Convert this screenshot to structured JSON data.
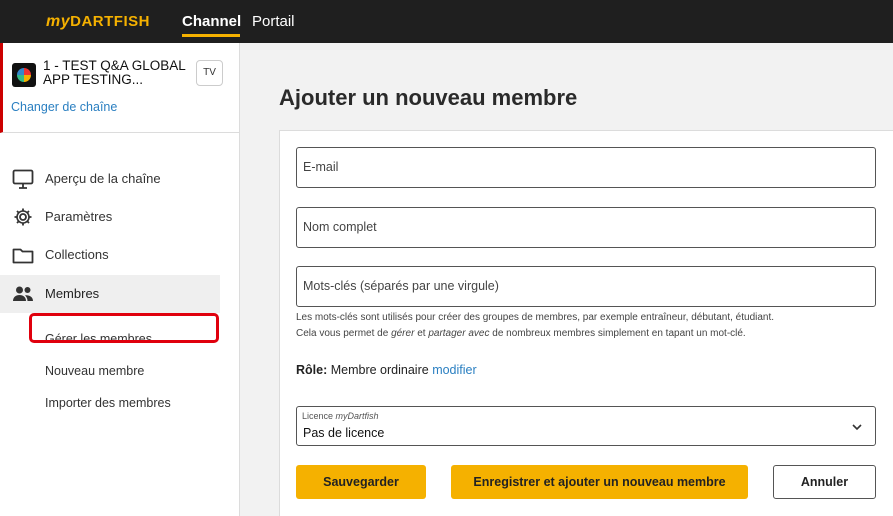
{
  "header": {
    "logo_my": "my",
    "logo_brand": "DARTFISH",
    "tabs": [
      {
        "label": "Channel",
        "active": true
      },
      {
        "label": "Portail",
        "active": false
      }
    ]
  },
  "sidebar": {
    "channel_name": "1 - TEST Q&A GLOBAL APP TESTING...",
    "channel_badge": "TV",
    "change_channel": "Changer de chaîne",
    "items": [
      {
        "label": "Aperçu de la chaîne",
        "icon": "monitor-icon"
      },
      {
        "label": "Paramètres",
        "icon": "gear-icon"
      },
      {
        "label": "Collections",
        "icon": "folder-icon"
      },
      {
        "label": "Membres",
        "icon": "users-icon",
        "active": true
      }
    ],
    "sub_items": [
      {
        "label": "Gérer les membres"
      },
      {
        "label": "Nouveau membre",
        "highlighted": true
      },
      {
        "label": "Importer des membres"
      }
    ]
  },
  "main": {
    "title": "Ajouter un nouveau membre",
    "fields": {
      "email_placeholder": "E-mail",
      "fullname_placeholder": "Nom complet",
      "keywords_placeholder": "Mots-clés (séparés par une virgule)"
    },
    "hint": {
      "line1": "Les mots-clés sont utilisés pour créer des groupes de membres, par exemple entraîneur, débutant, étudiant.",
      "line2_pre": "Cela vous permet de ",
      "line2_em1": "gérer",
      "line2_mid": " et ",
      "line2_em2": "partager avec",
      "line2_post": " de nombreux membres simplement en tapant un mot-clé."
    },
    "role": {
      "label": "Rôle:",
      "value": "Membre ordinaire",
      "modify": "modifier"
    },
    "license": {
      "caption_pre": "Licence ",
      "caption_brand": "myDartfish",
      "value": "Pas de licence"
    },
    "buttons": {
      "save": "Sauvegarder",
      "save_add": "Enregistrer et ajouter un nouveau membre",
      "cancel": "Annuler"
    }
  },
  "colors": {
    "accent": "#f5b100",
    "link": "#2a7fc1",
    "highlight": "#e0000d",
    "topbar": "#1f1f1f"
  }
}
